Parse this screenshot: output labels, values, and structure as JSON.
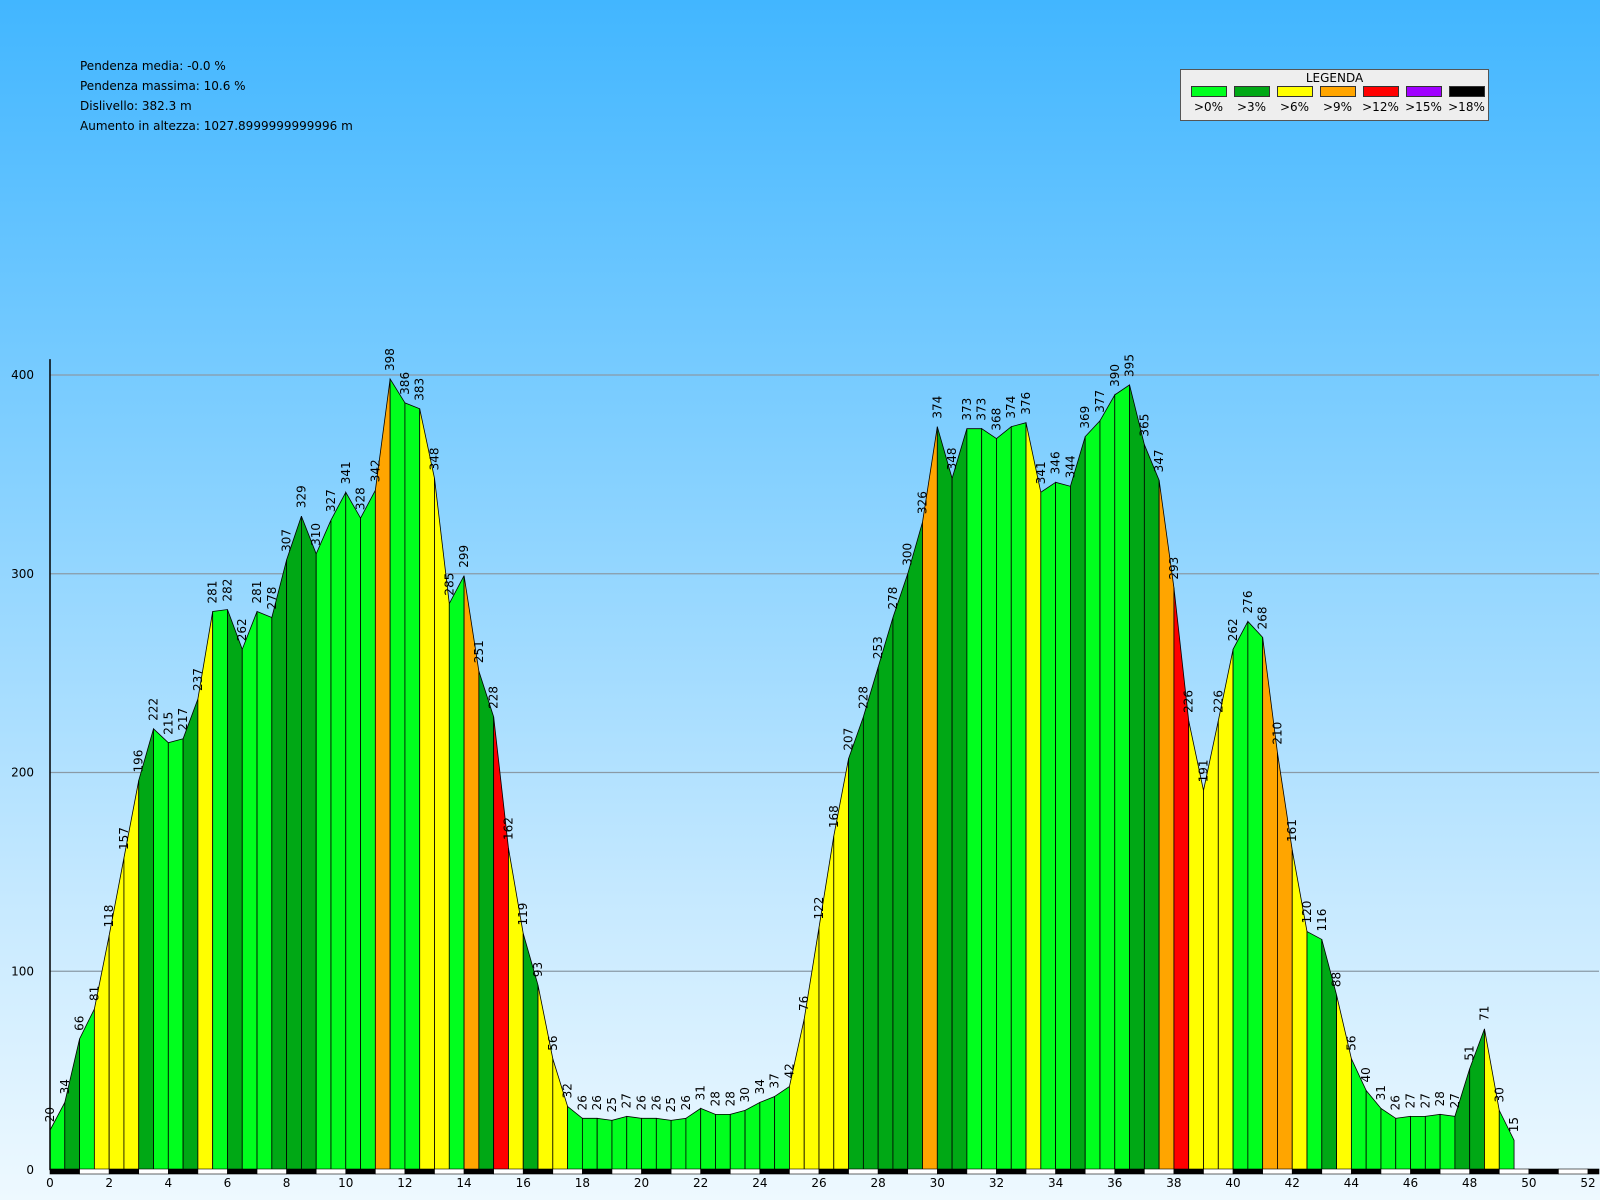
{
  "stats": {
    "pendenza_media": "Pendenza media: -0.0 %",
    "pendenza_massima": "Pendenza massima: 10.6 %",
    "dislivello": "Dislivello: 382.3 m",
    "aumento": "Aumento in altezza: 1027.8999999999996 m"
  },
  "legend": {
    "title": "LEGENDA",
    "items": [
      {
        "label": ">0%",
        "color": "#00ff1e"
      },
      {
        "label": ">3%",
        "color": "#00a815"
      },
      {
        "label": ">6%",
        "color": "#ffff00"
      },
      {
        "label": ">9%",
        "color": "#ffa500"
      },
      {
        "label": ">12%",
        "color": "#ff0000"
      },
      {
        "label": ">15%",
        "color": "#a000ff"
      },
      {
        "label": ">18%",
        "color": "#000000"
      }
    ]
  },
  "chart_data": {
    "type": "area",
    "xlabel": "",
    "ylabel": "",
    "xlim": [
      0,
      52.5
    ],
    "ylim": [
      0,
      400
    ],
    "x_ticks": [
      0,
      2,
      4,
      6,
      8,
      10,
      12,
      14,
      16,
      18,
      20,
      22,
      24,
      26,
      28,
      30,
      32,
      34,
      36,
      38,
      40,
      42,
      44,
      46,
      48,
      50,
      52
    ],
    "y_ticks": [
      0,
      100,
      200,
      300,
      400
    ],
    "grid": true,
    "legend_position": "top-right",
    "x": [
      0,
      0.5,
      1,
      1.5,
      2,
      2.5,
      3,
      3.5,
      4,
      4.5,
      5,
      5.5,
      6,
      6.5,
      7,
      7.5,
      8,
      8.5,
      9,
      9.5,
      10,
      10.5,
      11,
      11.5,
      12,
      12.5,
      13,
      13.5,
      14,
      14.5,
      15,
      15.5,
      16,
      16.5,
      17,
      17.5,
      18,
      18.5,
      19,
      19.5,
      20,
      20.5,
      21,
      21.5,
      22,
      22.5,
      23,
      23.5,
      24,
      24.5,
      25,
      25.5,
      26,
      26.5,
      27,
      27.5,
      28,
      28.5,
      29,
      29.5,
      30,
      30.5,
      31,
      31.5,
      32,
      32.5,
      33,
      33.5,
      34,
      34.5,
      35,
      35.5,
      36,
      36.5,
      37,
      37.5,
      38,
      38.5,
      39,
      39.5,
      40,
      40.5,
      41,
      41.5,
      42,
      42.5,
      43,
      43.5,
      44,
      44.5,
      45,
      45.5,
      46,
      46.5,
      47,
      47.5,
      48,
      48.5,
      49,
      49.5,
      50,
      50.5,
      51,
      51.5,
      52
    ],
    "elevation": [
      20,
      34,
      66,
      81,
      118,
      157,
      196,
      222,
      215,
      217,
      237,
      281,
      282,
      262,
      281,
      278,
      307,
      329,
      310,
      327,
      341,
      328,
      342,
      398,
      386,
      383,
      348,
      285,
      299,
      251,
      228,
      162,
      119,
      93,
      56,
      32,
      26,
      26,
      25,
      27,
      26,
      26,
      25,
      26,
      31,
      28,
      28,
      30,
      34,
      37,
      42,
      76,
      122,
      168,
      207,
      228,
      253,
      278,
      300,
      326,
      374,
      348,
      373,
      373,
      368,
      374,
      376,
      341,
      346,
      344,
      369,
      377,
      390,
      395,
      365,
      347,
      293,
      226,
      191,
      226,
      262,
      276,
      268,
      210,
      161,
      120,
      116,
      88,
      56,
      40,
      31,
      26,
      27,
      27,
      28,
      27,
      51,
      71,
      30,
      15
    ],
    "segment_grade_class": [
      0,
      1,
      0,
      2,
      2,
      2,
      1,
      0,
      0,
      1,
      2,
      0,
      1,
      0,
      0,
      1,
      1,
      1,
      0,
      0,
      0,
      0,
      3,
      0,
      0,
      2,
      2,
      0,
      3,
      1,
      4,
      2,
      1,
      2,
      2,
      0,
      0,
      0,
      0,
      0,
      0,
      0,
      0,
      0,
      0,
      0,
      0,
      0,
      0,
      0,
      2,
      2,
      2,
      2,
      1,
      1,
      1,
      1,
      1,
      3,
      1,
      1,
      0,
      0,
      0,
      0,
      2,
      0,
      0,
      1,
      0,
      0,
      0,
      1,
      1,
      3,
      4,
      2,
      2,
      2,
      0,
      0,
      3,
      3,
      2,
      0,
      1,
      2,
      0,
      0,
      0,
      0,
      0,
      0,
      0,
      1,
      1,
      2,
      0
    ]
  }
}
